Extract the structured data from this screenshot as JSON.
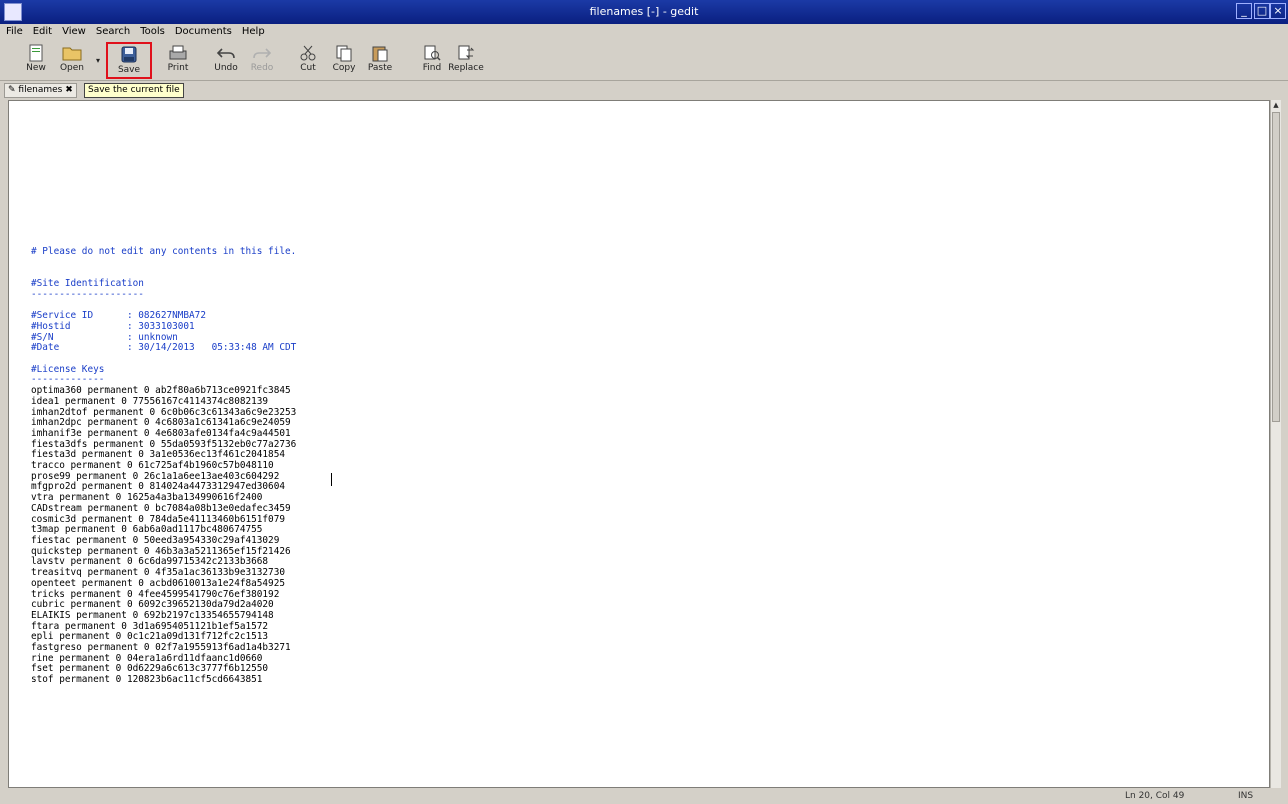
{
  "window": {
    "title": "filenames [-] - gedit",
    "minimize": "_",
    "maximize": "□",
    "close": "×"
  },
  "menu": [
    "File",
    "Edit",
    "View",
    "Search",
    "Tools",
    "Documents",
    "Help"
  ],
  "toolbar": {
    "new": "New",
    "open": "Open",
    "save": "Save",
    "print": "Print",
    "undo": "Undo",
    "redo": "Redo",
    "cut": "Cut",
    "copy": "Copy",
    "paste": "Paste",
    "find": "Find",
    "replace": "Replace"
  },
  "tab": {
    "label": "filenames",
    "tooltip": "Save the current file"
  },
  "document": {
    "lines": [
      {
        "text": "# Please do not edit any contents in this file.",
        "style": "comment"
      },
      {
        "text": "",
        "style": "comment"
      },
      {
        "text": "",
        "style": "comment"
      },
      {
        "text": "#Site Identification",
        "style": "comment"
      },
      {
        "text": "--------------------",
        "style": "comment"
      },
      {
        "text": "",
        "style": "comment"
      },
      {
        "text": "#Service ID      : 082627NMBA72",
        "style": "comment"
      },
      {
        "text": "#Hostid          : 3033103001",
        "style": "comment"
      },
      {
        "text": "#S/N             : unknown",
        "style": "comment"
      },
      {
        "text": "#Date            : 30/14/2013   05:33:48 AM CDT",
        "style": "comment"
      },
      {
        "text": "",
        "style": "comment"
      },
      {
        "text": "#License Keys",
        "style": "comment"
      },
      {
        "text": "-------------",
        "style": "comment"
      },
      {
        "text": "optima360 permanent 0 ab2f80a6b713ce0921fc3845",
        "style": "plain"
      },
      {
        "text": "idea1 permanent 0 77556167c4114374c8082139",
        "style": "plain"
      },
      {
        "text": "imhan2dtof permanent 0 6c0b06c3c61343a6c9e23253",
        "style": "plain"
      },
      {
        "text": "imhan2dpc permanent 0 4c6803a1c61341a6c9e24059",
        "style": "plain"
      },
      {
        "text": "imhanif3e permanent 0 4e6803afe0134fa4c9a44501",
        "style": "plain"
      },
      {
        "text": "fiesta3dfs permanent 0 55da0593f5132eb0c77a2736",
        "style": "plain"
      },
      {
        "text": "fiesta3d permanent 0 3a1e0536ec13f461c2041854",
        "style": "plain"
      },
      {
        "text": "tracco permanent 0 61c725af4b1960c57b048110",
        "style": "plain"
      },
      {
        "text": "prose99 permanent 0 26c1a1a6ee13ae403c604292",
        "style": "plain"
      },
      {
        "text": "mfgpro2d permanent 0 814024a4473312947ed30604",
        "style": "plain"
      },
      {
        "text": "vtra permanent 0 1625a4a3ba134990616f2400",
        "style": "plain"
      },
      {
        "text": "CADstream permanent 0 bc7084a08b13e0edafec3459",
        "style": "plain"
      },
      {
        "text": "cosmic3d permanent 0 784da5e41113460b6151f079",
        "style": "plain"
      },
      {
        "text": "t3map permanent 0 6ab6a0ad1117bc480674755",
        "style": "plain"
      },
      {
        "text": "fiestac permanent 0 50eed3a954330c29af413029",
        "style": "plain"
      },
      {
        "text": "quickstep permanent 0 46b3a3a5211365ef15f21426",
        "style": "plain"
      },
      {
        "text": "lavstv permanent 0 6c6da99715342c2133b3668",
        "style": "plain"
      },
      {
        "text": "treasitvq permanent 0 4f35a1ac36133b9e3132730",
        "style": "plain"
      },
      {
        "text": "openteet permanent 0 acbd0610013a1e24f8a54925",
        "style": "plain"
      },
      {
        "text": "tricks permanent 0 4fee4599541790c76ef380192",
        "style": "plain"
      },
      {
        "text": "cubric permanent 0 6092c39652130da79d2a4020",
        "style": "plain"
      },
      {
        "text": "ELAIKIS permanent 0 692b2197c13354655794148",
        "style": "plain"
      },
      {
        "text": "ftara permanent 0 3d1a6954051121b1ef5a1572",
        "style": "plain"
      },
      {
        "text": "epli permanent 0 0c1c21a09d131f712fc2c1513",
        "style": "plain"
      },
      {
        "text": "fastgreso permanent 0 02f7a1955913f6ad1a4b3271",
        "style": "plain"
      },
      {
        "text": "rine permanent 0 04era1a6rd11dfaanc1d0660",
        "style": "plain"
      },
      {
        "text": "fset permanent 0 0d6229a6c613c3777f6b12550",
        "style": "plain"
      },
      {
        "text": "stof permanent 0 120823b6ac11cf5cd6643851",
        "style": "plain"
      }
    ]
  },
  "status": {
    "position": "Ln 20, Col 49",
    "mode": "INS"
  }
}
